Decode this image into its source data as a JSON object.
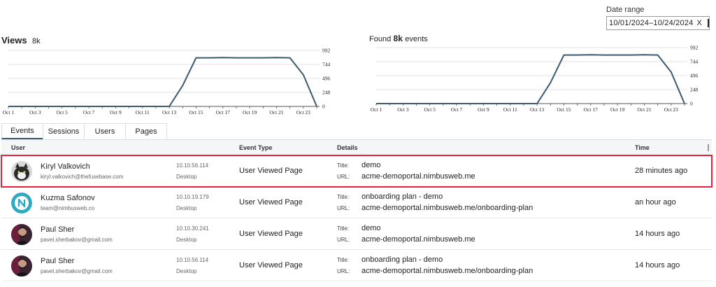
{
  "date_range": {
    "label": "Date range",
    "start": "10/01/2024",
    "separator": "–",
    "end": "10/24/2024",
    "clear_label": "X",
    "icon": "calendar-icon"
  },
  "chart_data": [
    {
      "type": "line",
      "title": "Views",
      "subtitle": "8k",
      "x": [
        "Oct 1",
        "Oct 2",
        "Oct 3",
        "Oct 4",
        "Oct 5",
        "Oct 6",
        "Oct 7",
        "Oct 8",
        "Oct 9",
        "Oct 10",
        "Oct 11",
        "Oct 12",
        "Oct 13",
        "Oct 14",
        "Oct 15",
        "Oct 16",
        "Oct 17",
        "Oct 18",
        "Oct 19",
        "Oct 20",
        "Oct 21",
        "Oct 22",
        "Oct 23",
        "Oct 24"
      ],
      "x_tick_labels": [
        "Oct 1",
        "Oct 3",
        "Oct 5",
        "Oct 7",
        "Oct 9",
        "Oct 11",
        "Oct 13",
        "Oct 15",
        "Oct 17",
        "Oct 19",
        "Oct 21",
        "Oct 23"
      ],
      "series": [
        {
          "values": [
            0,
            0,
            0,
            0,
            0,
            0,
            0,
            0,
            0,
            0,
            0,
            0,
            0,
            370,
            860,
            860,
            865,
            860,
            860,
            860,
            865,
            860,
            560,
            0
          ],
          "color": "#3b5a6e"
        }
      ],
      "y_ticks": [
        0,
        248,
        496,
        744,
        992
      ],
      "ylim": [
        0,
        992
      ],
      "grid": true,
      "y_axis_side": "right"
    },
    {
      "type": "line",
      "title_prefix": "Found",
      "title_count": "8k",
      "title_suffix": "events",
      "x": [
        "Oct 1",
        "Oct 2",
        "Oct 3",
        "Oct 4",
        "Oct 5",
        "Oct 6",
        "Oct 7",
        "Oct 8",
        "Oct 9",
        "Oct 10",
        "Oct 11",
        "Oct 12",
        "Oct 13",
        "Oct 14",
        "Oct 15",
        "Oct 16",
        "Oct 17",
        "Oct 18",
        "Oct 19",
        "Oct 20",
        "Oct 21",
        "Oct 22",
        "Oct 23",
        "Oct 24"
      ],
      "x_tick_labels": [
        "Oct 1",
        "Oct 3",
        "Oct 5",
        "Oct 7",
        "Oct 9",
        "Oct 11",
        "Oct 13",
        "Oct 15",
        "Oct 17",
        "Oct 19",
        "Oct 21",
        "Oct 23"
      ],
      "series": [
        {
          "values": [
            0,
            0,
            0,
            0,
            0,
            0,
            0,
            0,
            0,
            0,
            0,
            0,
            0,
            370,
            860,
            860,
            865,
            860,
            860,
            860,
            865,
            860,
            560,
            0
          ],
          "color": "#3b5a6e"
        }
      ],
      "y_ticks": [
        0,
        248,
        496,
        744,
        992
      ],
      "ylim": [
        0,
        992
      ],
      "grid": true,
      "y_axis_side": "right"
    }
  ],
  "tabs": [
    {
      "label": "Events",
      "active": true
    },
    {
      "label": "Sessions",
      "active": false
    },
    {
      "label": "Users",
      "active": false
    },
    {
      "label": "Pages",
      "active": false
    }
  ],
  "table": {
    "headers": {
      "user": "User",
      "event_type": "Event Type",
      "details": "Details",
      "time": "Time"
    },
    "rows": [
      {
        "name": "Kiryl Valkovich",
        "email": "kiryl.valkovich@thefusebase.com",
        "ip": "10.10.56.114",
        "device": "Desktop",
        "event_type": "User Viewed Page",
        "title_label": "Title:",
        "title": "demo",
        "url_label": "URL:",
        "url": "acme-demoportal.nimbusweb.me",
        "time": "28 minutes ago",
        "avatar": "cat-avatar",
        "selected": true
      },
      {
        "name": "Kuzma Safonov",
        "email": "team@nimbusweb.co",
        "ip": "10.10.19.179",
        "device": "Desktop",
        "event_type": "User Viewed Page",
        "title_label": "Title:",
        "title": "onboarding plan - demo",
        "url_label": "URL:",
        "url": "acme-demoportal.nimbusweb.me/onboarding-plan",
        "time": "an hour ago",
        "avatar": "nimbus-logo-avatar",
        "selected": false
      },
      {
        "name": "Paul Sher",
        "email": "pavel.sherbakov@gmail.com",
        "ip": "10.10.30.241",
        "device": "Desktop",
        "event_type": "User Viewed Page",
        "title_label": "Title:",
        "title": "demo",
        "url_label": "URL:",
        "url": "acme-demoportal.nimbusweb.me",
        "time": "14 hours ago",
        "avatar": "person-avatar",
        "selected": false
      },
      {
        "name": "Paul Sher",
        "email": "pavel.sherbakov@gmail.com",
        "ip": "10.10.56.114",
        "device": "Desktop",
        "event_type": "User Viewed Page",
        "title_label": "Title:",
        "title": "onboarding plan - demo",
        "url_label": "URL:",
        "url": "acme-demoportal.nimbusweb.me/onboarding-plan",
        "time": "14 hours ago",
        "avatar": "person-avatar",
        "selected": false
      }
    ]
  }
}
